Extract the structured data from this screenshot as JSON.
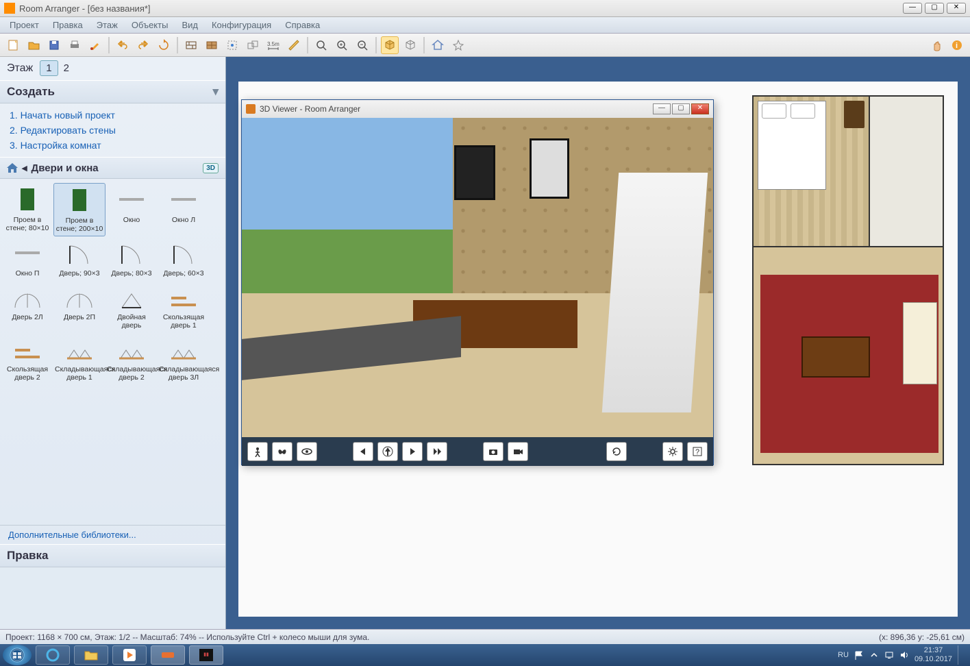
{
  "titlebar": {
    "app": "Room Arranger",
    "doc": "[без названия*]"
  },
  "menu": [
    "Проект",
    "Правка",
    "Этаж",
    "Объекты",
    "Вид",
    "Конфигурация",
    "Справка"
  ],
  "toolbar_icons": [
    "new",
    "open",
    "save",
    "print",
    "paint",
    "undo",
    "redo",
    "rotate",
    "wall",
    "grid",
    "snap",
    "group",
    "measure",
    "ruler2",
    "zoom-fit",
    "zoom-in",
    "zoom-out",
    "view3d",
    "view3d-settings",
    "house",
    "fx"
  ],
  "toolbar_right": [
    "hand",
    "info"
  ],
  "sidebar": {
    "floor_label": "Этаж",
    "floors": [
      "1",
      "2"
    ],
    "active_floor": 0,
    "create_label": "Создать",
    "actions": [
      "1. Начать новый проект",
      "2. Редактировать стены",
      "3. Настройка комнат"
    ],
    "category_label": "Двери и окна",
    "badge3d": "3D",
    "library": [
      {
        "name": "Проем в стене; 80×10",
        "thumb": "door-solid"
      },
      {
        "name": "Проем в стене; 200×10",
        "thumb": "door-solid",
        "selected": true
      },
      {
        "name": "Окно",
        "thumb": "window"
      },
      {
        "name": "Окно Л",
        "thumb": "window"
      },
      {
        "name": "Окно П",
        "thumb": "window"
      },
      {
        "name": "Дверь; 90×3",
        "thumb": "door-arc"
      },
      {
        "name": "Дверь; 80×3",
        "thumb": "door-arc"
      },
      {
        "name": "Дверь; 60×3",
        "thumb": "door-arc"
      },
      {
        "name": "Дверь 2Л",
        "thumb": "door-double"
      },
      {
        "name": "Дверь 2П",
        "thumb": "door-double"
      },
      {
        "name": "Двойная дверь",
        "thumb": "door-dd"
      },
      {
        "name": "Скользящая дверь 1",
        "thumb": "slide"
      },
      {
        "name": "Скользящая дверь 2",
        "thumb": "slide"
      },
      {
        "name": "Складывающаяся дверь 1",
        "thumb": "fold"
      },
      {
        "name": "Складывающаяся дверь 2",
        "thumb": "fold"
      },
      {
        "name": "Складывающаяся дверь 3Л",
        "thumb": "fold"
      }
    ],
    "morelink": "Дополнительные библиотеки...",
    "edit_label": "Правка"
  },
  "viewer3d": {
    "title": "3D Viewer - Room Arranger",
    "buttons": [
      "walk",
      "butterfly",
      "eye",
      "prev",
      "center",
      "play",
      "fwd",
      "camera",
      "video",
      "refresh",
      "settings",
      "help"
    ]
  },
  "statusbar": {
    "left": "Проект: 1168 × 700 см, Этаж: 1/2 -- Масштаб: 74% -- Используйте Ctrl + колесо мыши для зума.",
    "right": "(x: 896,36 y: -25,61 см)"
  },
  "taskbar": {
    "lang": "RU",
    "time": "21:37",
    "date": "09.10.2017"
  }
}
